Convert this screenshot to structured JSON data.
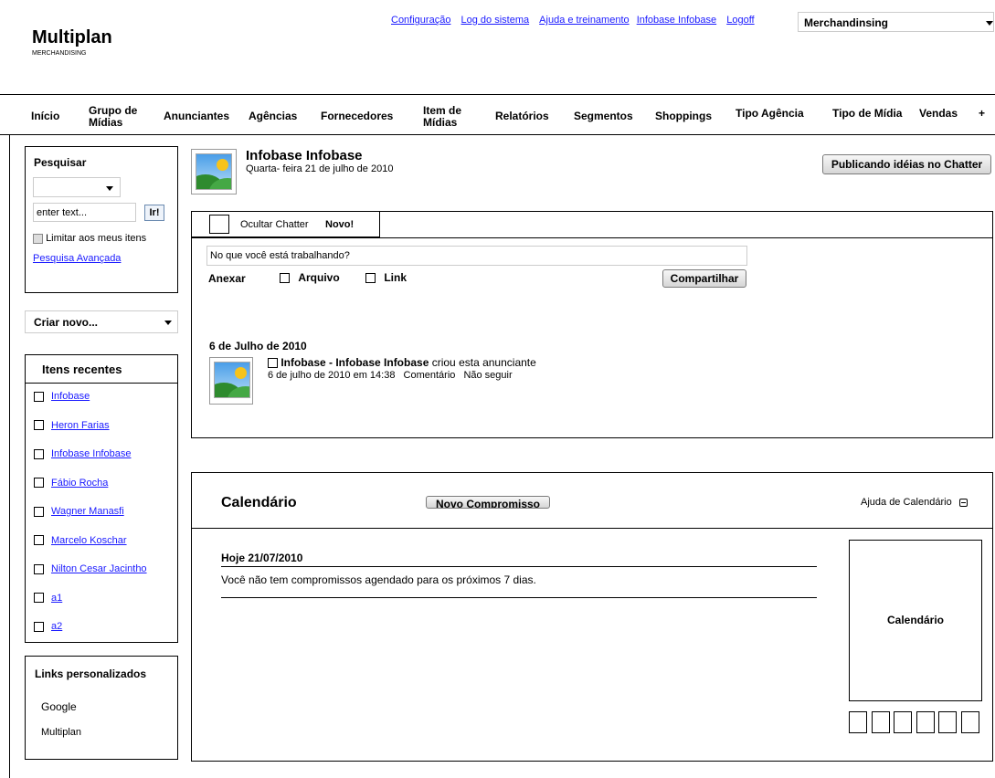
{
  "header": {
    "app_title": "Multiplan",
    "app_subtitle": "MERCHANDISING",
    "links": [
      "Configuração",
      "Log do sistema",
      "Ajuda e treinamento",
      "Infobase Infobase",
      "Logoff"
    ],
    "app_selector": "Merchandinsing"
  },
  "nav": {
    "items": [
      "Início",
      "Grupo de Mídias",
      "Anunciantes",
      "Agências",
      "Fornecedores",
      "Item de Mídias",
      "Relatórios",
      "Segmentos",
      "Shoppings",
      "Tipo Agência",
      "Tipo de Mídia",
      "Vendas",
      "+"
    ]
  },
  "sidebar": {
    "search": {
      "title": "Pesquisar",
      "placeholder": "enter text...",
      "go_label": "Ir!",
      "limit_label": "Limitar aos meus itens",
      "advanced_label": "Pesquisa Avançada"
    },
    "create_new": "Criar novo...",
    "recent": {
      "title": "Itens recentes",
      "items": [
        "Infobase",
        "Heron Farias",
        "Infobase Infobase",
        "Fábio Rocha",
        "Wagner Manasfi",
        "Marcelo Koschar",
        "Nilton Cesar Jacintho",
        "a1",
        "a2"
      ]
    },
    "custom_links": {
      "title": "Links personalizados",
      "items": [
        "Google",
        "Multiplan"
      ]
    }
  },
  "profile": {
    "name": "Infobase Infobase",
    "date": "Quarta- feira 21 de julho de 2010",
    "chatter_button": "Publicando idéias no Chatter"
  },
  "chatter": {
    "hide_label": "Ocultar Chatter",
    "new_label": "Novo!",
    "post_placeholder": "No que você está trabalhando?",
    "attach_label": "Anexar",
    "file_label": "Arquivo",
    "link_label": "Link",
    "share_label": "Compartilhar",
    "feed_date": "6 de Julho de 2010",
    "feed_item": {
      "author": "Infobase - Infobase Infobase",
      "action": "criou esta anunciante",
      "timestamp": "6 de julho de 2010 em 14:38",
      "comment_label": "Comentário",
      "unfollow_label": "Não seguir"
    }
  },
  "calendar": {
    "title": "Calendário",
    "new_appointment": "Novo Compromisso",
    "help_label": "Ajuda de Calendário",
    "today": "Hoje 21/07/2010",
    "no_events": "Você não tem compromissos agendado para os próximos 7 dias.",
    "widget_label": "Calendário"
  }
}
